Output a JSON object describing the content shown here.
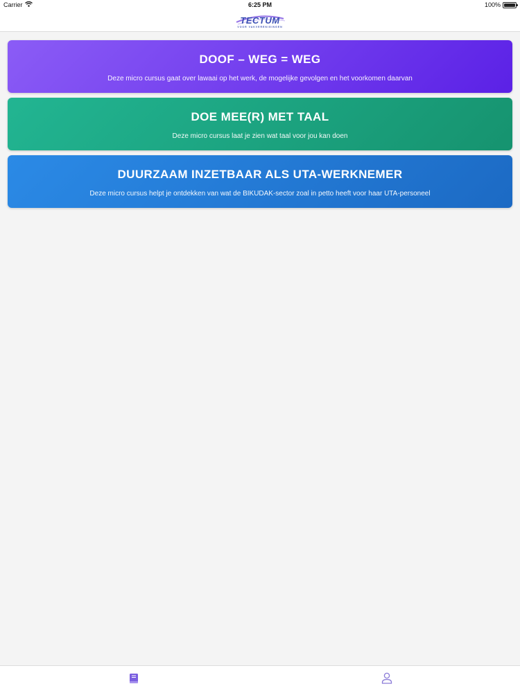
{
  "status_bar": {
    "carrier": "Carrier",
    "time": "6:25 PM",
    "battery": "100%"
  },
  "header": {
    "logo_text": "TECTUM",
    "logo_tagline": "VOOR VAKVERENIGINGEN"
  },
  "courses": [
    {
      "title": "DOOF – WEG = WEG",
      "description": "Deze micro cursus gaat over lawaai op het werk, de mogelijke gevolgen en het voorkomen daarvan",
      "gradient_start": "#8b5cf6",
      "gradient_end": "#5b21e6"
    },
    {
      "title": "DOE MEE(R) MET TAAL",
      "description": "Deze micro cursus laat je zien wat taal voor jou kan doen",
      "gradient_start": "#22b592",
      "gradient_end": "#16936f"
    },
    {
      "title": "DUURZAAM INZETBAAR ALS UTA-WERKNEMER",
      "description": "Deze micro cursus helpt je ontdekken van wat de BIKUDAK-sector zoal in petto heeft voor haar UTA-personeel",
      "gradient_start": "#2b8ae6",
      "gradient_end": "#1c6ac4"
    }
  ],
  "tab_bar": {
    "tabs": [
      {
        "icon": "book-icon",
        "active": true
      },
      {
        "icon": "person-icon",
        "active": false
      }
    ],
    "active_color": "#7b5fe0",
    "inactive_color": "#8a7ad8"
  }
}
